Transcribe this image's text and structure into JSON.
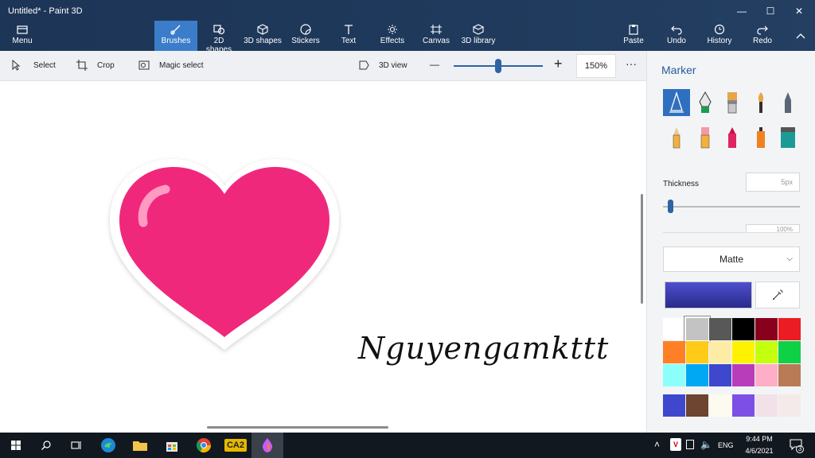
{
  "window": {
    "title": "Untitled* - Paint 3D",
    "minimize": "—",
    "maximize": "☐",
    "close": "✕"
  },
  "ribbon": {
    "menu": "Menu",
    "tools": [
      {
        "label": "Brushes",
        "icon": "brush-icon",
        "active": true
      },
      {
        "label": "2D shapes",
        "icon": "2d-shapes-icon"
      },
      {
        "label": "3D shapes",
        "icon": "3d-shapes-icon"
      },
      {
        "label": "Stickers",
        "icon": "stickers-icon"
      },
      {
        "label": "Text",
        "icon": "text-icon"
      },
      {
        "label": "Effects",
        "icon": "effects-icon"
      },
      {
        "label": "Canvas",
        "icon": "canvas-icon"
      },
      {
        "label": "3D library",
        "icon": "3d-library-icon"
      }
    ],
    "right": [
      {
        "label": "Paste",
        "icon": "paste-icon"
      },
      {
        "label": "Undo",
        "icon": "undo-icon"
      },
      {
        "label": "History",
        "icon": "history-icon"
      },
      {
        "label": "Redo",
        "icon": "redo-icon"
      }
    ]
  },
  "toolbar": {
    "select": "Select",
    "crop": "Crop",
    "magic_select": "Magic select",
    "view_3d": "3D view",
    "zoom_minus": "—",
    "zoom_plus": "+",
    "zoom_value": "150%",
    "zoom_fraction": 0.5,
    "more": "···"
  },
  "canvas": {
    "handwriting": "Nguyengamkttt",
    "heart_color": "#f0287c"
  },
  "panel": {
    "title": "Marker",
    "brushes": [
      {
        "name": "marker-brush-icon",
        "active": true
      },
      {
        "name": "calligraphy-pen-icon"
      },
      {
        "name": "oil-brush-icon"
      },
      {
        "name": "watercolor-icon"
      },
      {
        "name": "pixel-pen-icon"
      },
      {
        "name": "pencil-icon"
      },
      {
        "name": "eraser-icon"
      },
      {
        "name": "crayon-icon"
      },
      {
        "name": "spray-can-icon"
      },
      {
        "name": "fill-bucket-icon"
      }
    ],
    "thickness_label": "Thickness",
    "thickness_value": "5px",
    "opacity_value": "100%",
    "finish": "Matte",
    "selected_color": "#3c3dbd",
    "palette": [
      "#ffffff",
      "#c3c3c3",
      "#585858",
      "#000000",
      "#88001b",
      "#ec1c24",
      "#ff7f27",
      "#ffca18",
      "#fdeca6",
      "#fff200",
      "#c4ff0e",
      "#0ed145",
      "#8cfffb",
      "#00a8f3",
      "#3f48cc",
      "#b83dba",
      "#ffaec8",
      "#b97a56"
    ],
    "custom_colors": [
      "#3f48cc",
      "#6d4531",
      "#fdfbf0",
      "#7d4fe6",
      "#f3e1e9",
      "#f4eaea"
    ]
  },
  "taskbar": {
    "apps": [
      {
        "name": "start-icon"
      },
      {
        "name": "search-icon"
      },
      {
        "name": "task-view-icon"
      },
      {
        "name": "edge-icon"
      },
      {
        "name": "file-explorer-icon"
      },
      {
        "name": "store-icon"
      },
      {
        "name": "chrome-icon"
      },
      {
        "name": "ca2-icon",
        "label": "CA2"
      },
      {
        "name": "paint-3d-icon",
        "active": true
      }
    ],
    "lang": "ENG",
    "time": "9:44 PM",
    "date": "4/6/2021",
    "notifications": "3"
  }
}
